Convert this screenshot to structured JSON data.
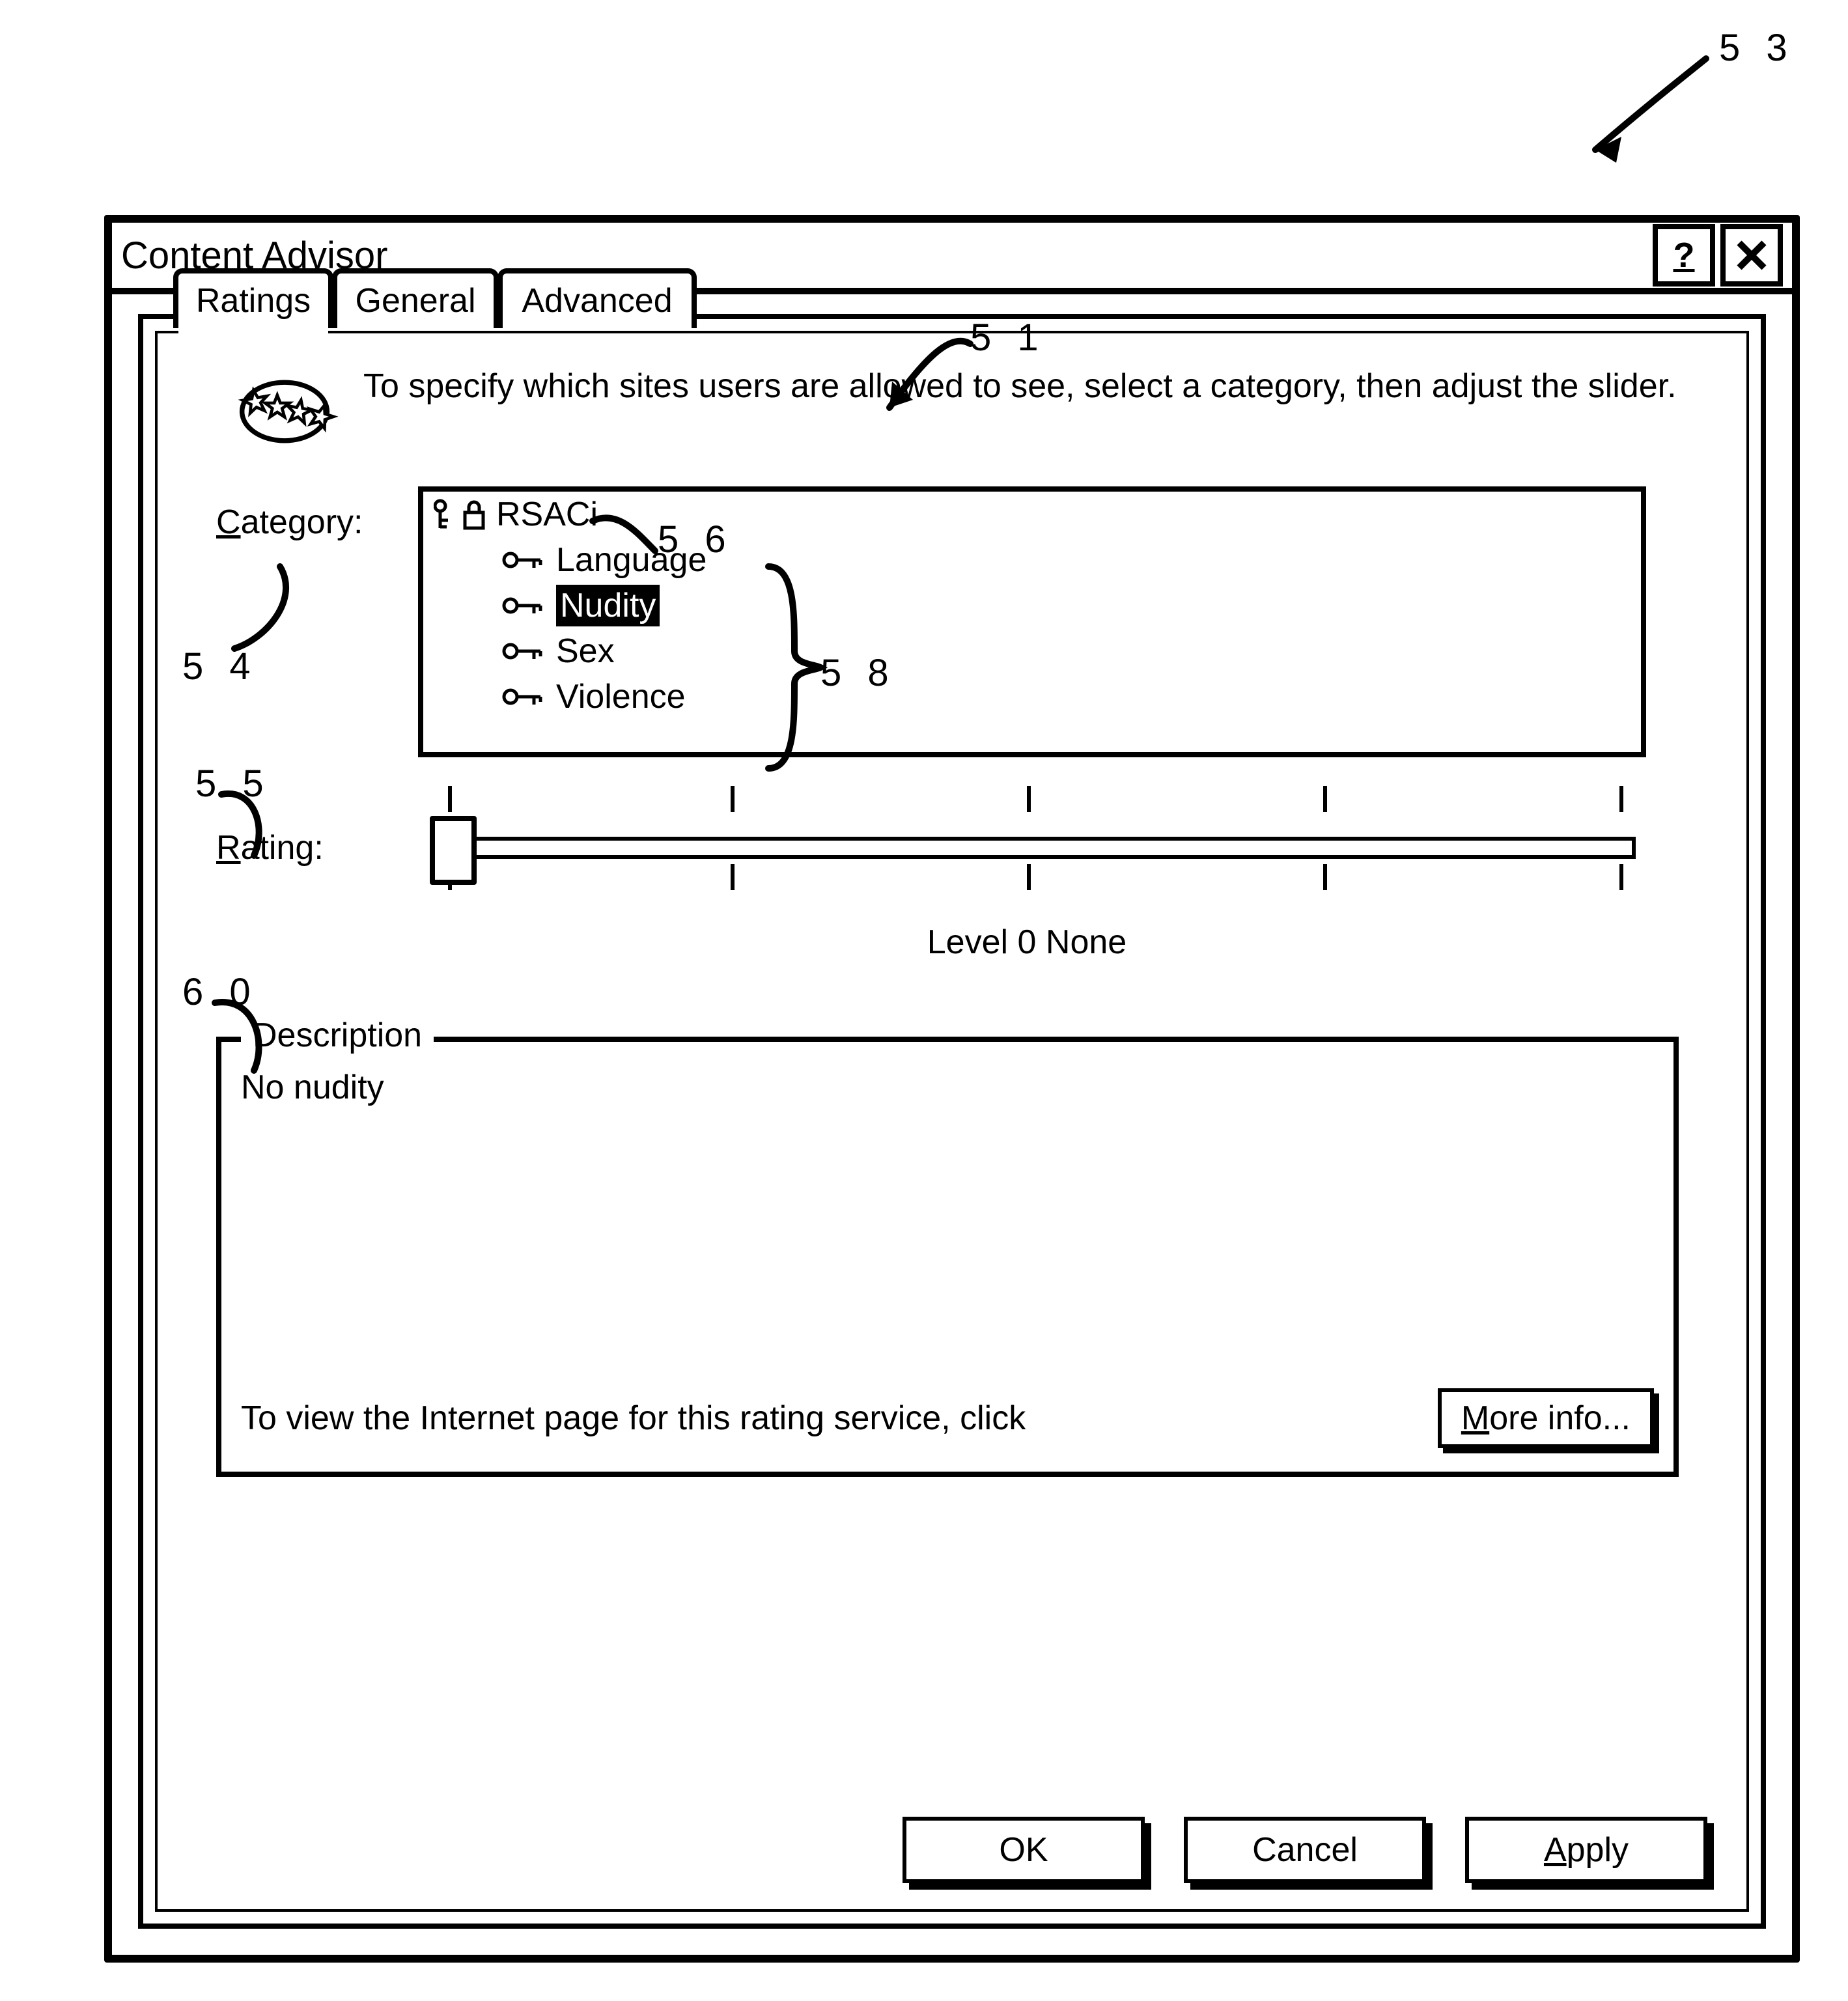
{
  "figure_ref": "53",
  "window_title": "Content Advisor",
  "tabs": {
    "ratings": "Ratings",
    "general": "General",
    "advanced": "Advanced",
    "active": "ratings"
  },
  "instruction": "To specify which sites users are allowed to see, select a category, then adjust the slider.",
  "labels": {
    "category": "Category:",
    "rating": "Rating:",
    "description": "Description"
  },
  "category_tree": {
    "root": "RSACi",
    "items": [
      "Language",
      "Nudity",
      "Sex",
      "Violence"
    ],
    "selected": "Nudity"
  },
  "rating_value": "Level 0   None",
  "description_text": "No nudity",
  "description_hint": "To view the Internet page for this rating service, click",
  "more_info": "More info...",
  "buttons": {
    "ok": "OK",
    "cancel": "Cancel",
    "apply": "Apply"
  },
  "callouts": {
    "c51": "5 1",
    "c53": "5 3",
    "c54": "5 4",
    "c55": "5 5",
    "c56": "5 6",
    "c58": "5 8",
    "c60": "6 0"
  }
}
